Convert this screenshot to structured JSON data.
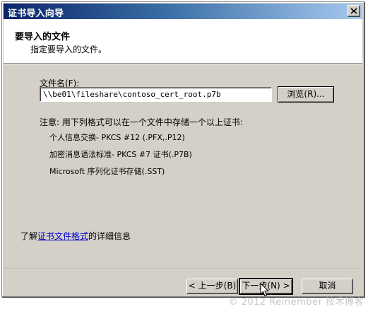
{
  "window": {
    "title": "证书导入向导",
    "close_icon": "close-x-icon"
  },
  "header": {
    "title": "要导入的文件",
    "subtitle": "指定要导入的文件。"
  },
  "form": {
    "file_label": "文件名(F):",
    "file_value": "\\\\be01\\fileshare\\contoso_cert_root.p7b",
    "browse_label": "浏览(R)..."
  },
  "note": {
    "text": "注意: 用下列格式可以在一个文件中存储一个以上证书:",
    "formats": [
      "个人信息交换- PKCS #12 (.PFX,.P12)",
      "加密消息语法标准- PKCS #7 证书(.P7B)",
      "Microsoft 序列化证书存储(.SST)"
    ]
  },
  "more_info": {
    "prefix": "了解",
    "link": "证书文件格式",
    "suffix": "的详细信息"
  },
  "footer": {
    "back_label": "< 上一步(B)",
    "next_label": "下一步(N) >",
    "cancel_label": "取消"
  },
  "watermark": "© 2012 Reinember 技术博客",
  "colors": {
    "titlebar_start": "#0a246a",
    "titlebar_end": "#a6caf0",
    "face": "#d4d0c8",
    "link": "#0000cc"
  }
}
